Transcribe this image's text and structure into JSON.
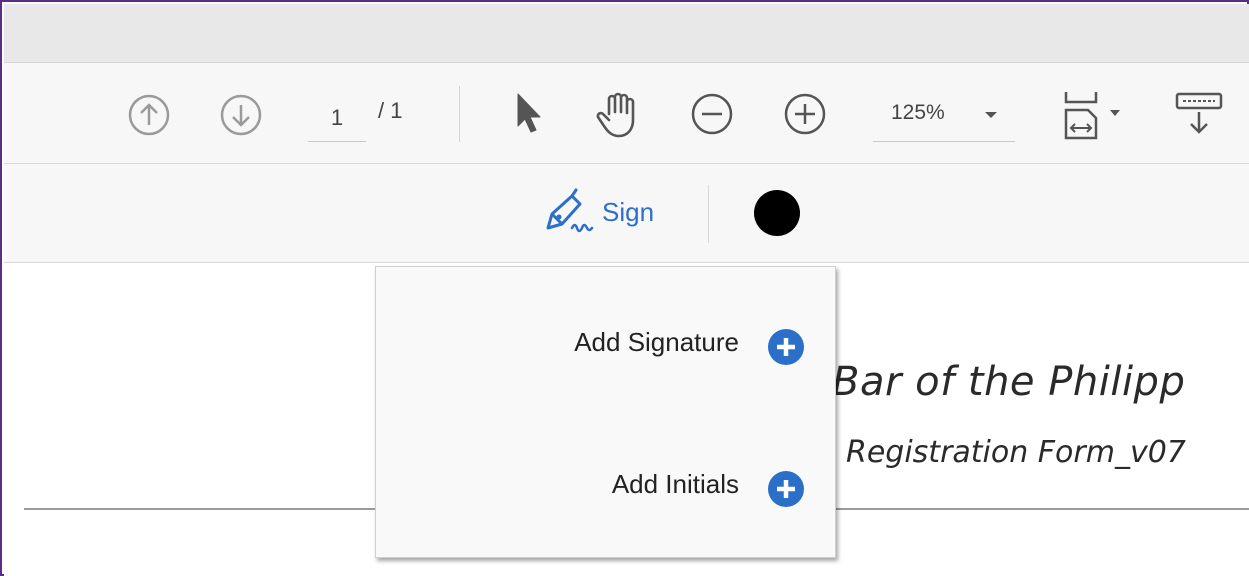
{
  "toolbar": {
    "current_page": "1",
    "page_total": "/ 1",
    "zoom_value": "125%",
    "icons": [
      "arrow-up-circle",
      "arrow-down-circle",
      "cursor-arrow",
      "hand",
      "zoom-out",
      "zoom-in",
      "fit-page",
      "scroll-mode"
    ]
  },
  "signbar": {
    "sign_label": "Sign",
    "ink_color": "#000000",
    "accent_color": "#2b6fc9"
  },
  "document": {
    "title": "Bar of the Philipp",
    "subtitle": "Registration Form_v07"
  },
  "menu": {
    "items": [
      {
        "label": "Add Signature"
      },
      {
        "label": "Add Initials"
      }
    ]
  }
}
